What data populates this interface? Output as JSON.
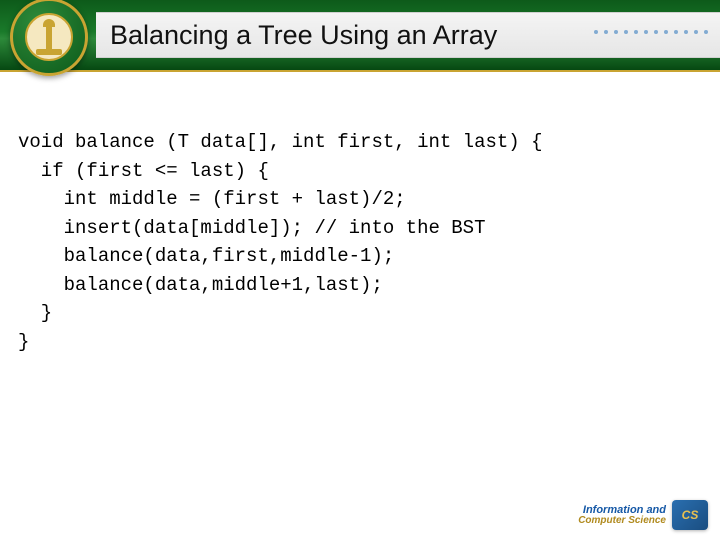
{
  "header": {
    "title": "Balancing a Tree Using an Array",
    "logo_name": "university-seal"
  },
  "code": {
    "lines": [
      "void balance (T data[], int first, int last) {",
      "  if (first <= last) {",
      "    int middle = (first + last)/2;",
      "    insert(data[middle]); // into the BST",
      "    balance(data,first,middle-1);",
      "    balance(data,middle+1,last);",
      "  }",
      "}"
    ]
  },
  "footer": {
    "line1": "Information and",
    "line2": "Computer Science",
    "badge": "CS"
  }
}
